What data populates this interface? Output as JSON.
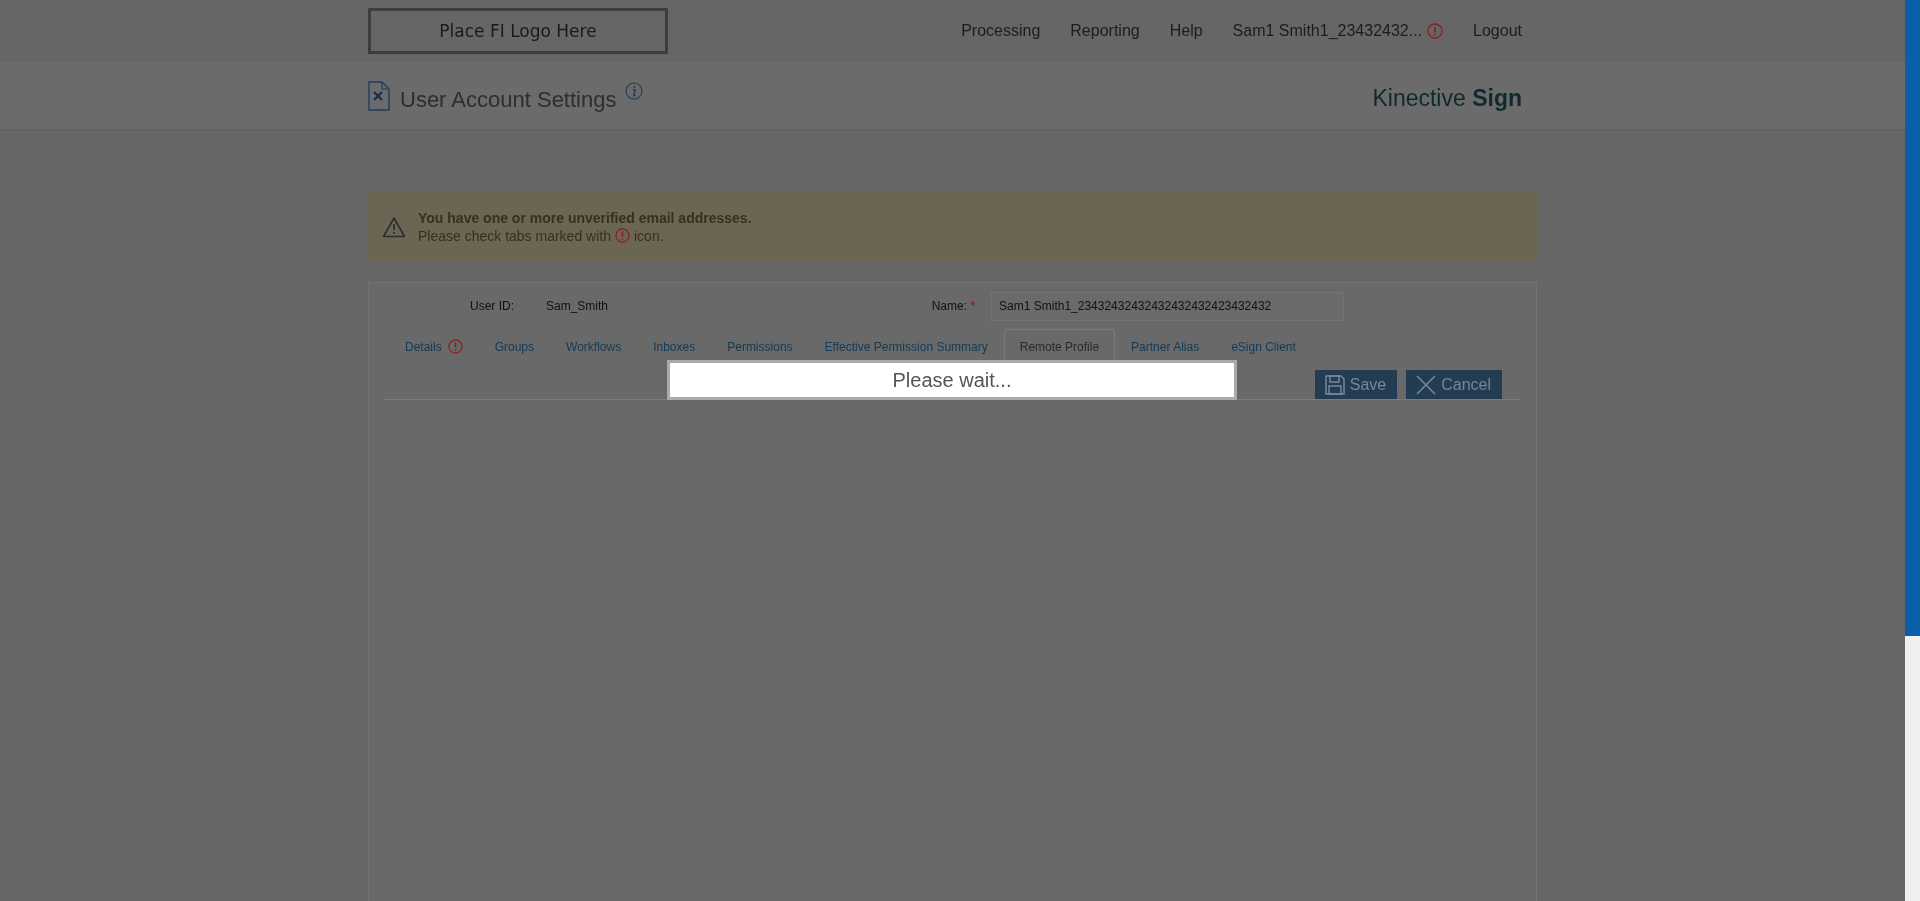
{
  "header": {
    "logo": "Place FI Logo Here",
    "nav": [
      {
        "label": "Processing",
        "warning": false
      },
      {
        "label": "Reporting",
        "warning": false
      },
      {
        "label": "Help",
        "warning": false
      },
      {
        "label": "Sam1 Smith1_23432432...",
        "warning": true
      },
      {
        "label": "Logout",
        "warning": false
      }
    ]
  },
  "page_title": "User Account Settings",
  "brand": "Kinective **Sign**",
  "alert": {
    "title": "You have one or more unverified email addresses.",
    "message_before": "Please check tabs marked with",
    "message_after": "icon."
  },
  "form": {
    "user_id_label": "User ID:",
    "user_id": "Sam_Smith",
    "name_label": "Name:",
    "name_required_mark": "*",
    "name_value": "Sam1 Smith1_23432432432432432432423432432"
  },
  "tabs": [
    {
      "label": "Details",
      "selected": false,
      "warning": true
    },
    {
      "label": "Groups",
      "selected": false,
      "warning": false
    },
    {
      "label": "Workflows",
      "selected": false,
      "warning": false
    },
    {
      "label": "Inboxes",
      "selected": false,
      "warning": false
    },
    {
      "label": "Permissions",
      "selected": false,
      "warning": false
    },
    {
      "label": "Effective Permission Summary",
      "selected": false,
      "warning": false
    },
    {
      "label": "Remote Profile",
      "selected": true,
      "warning": false
    },
    {
      "label": "Partner Alias",
      "selected": false,
      "warning": false
    },
    {
      "label": "eSign Client",
      "selected": false,
      "warning": false
    }
  ],
  "buttons": [
    {
      "label": "Save",
      "kind": "save"
    },
    {
      "label": "Cancel",
      "kind": "cancel"
    }
  ],
  "loading": "Please wait..."
}
